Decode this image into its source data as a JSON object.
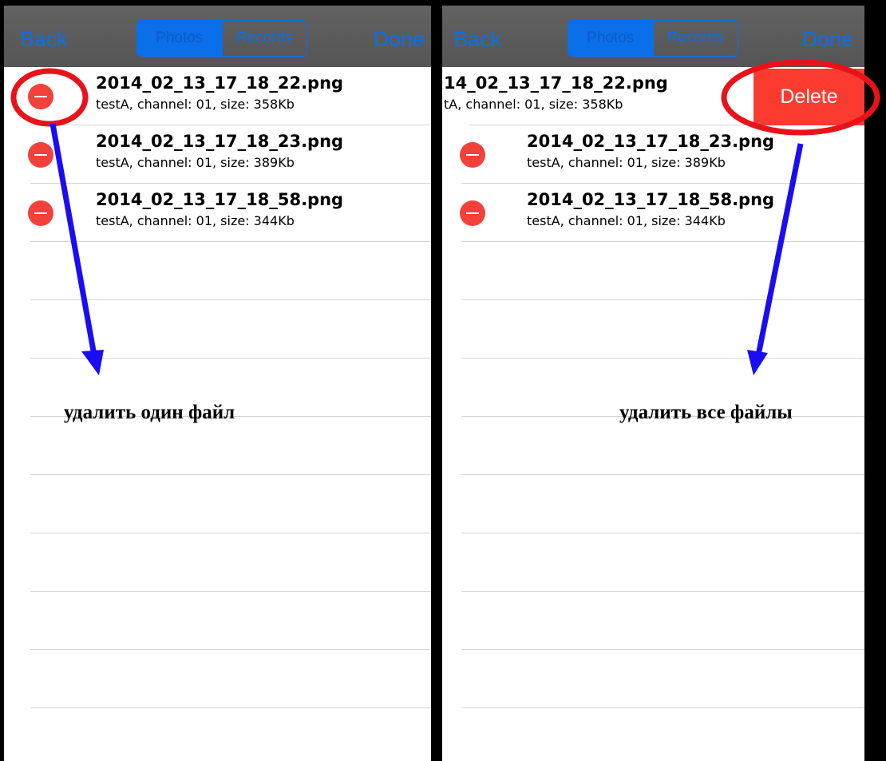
{
  "navbar": {
    "back_label": "Back",
    "done_label": "Done",
    "segments": [
      "Photos",
      "Records"
    ]
  },
  "files": [
    {
      "name": "2014_02_13_17_18_22.png",
      "meta": "testA, channel: 01, size: 358Kb"
    },
    {
      "name": "2014_02_13_17_18_23.png",
      "meta": "testA, channel: 01, size: 389Kb"
    },
    {
      "name": "2014_02_13_17_18_58.png",
      "meta": "testA, channel: 01, size: 344Kb"
    }
  ],
  "right_row1": {
    "name": "14_02_13_17_18_22.png",
    "meta": "tA, channel: 01, size: 358Kb"
  },
  "delete_label": "Delete",
  "annotations": {
    "left_caption": "удалить один файл",
    "right_caption": "удалить все файлы",
    "circle_color": "#e8131a",
    "arrow_color": "#1a0df2"
  }
}
